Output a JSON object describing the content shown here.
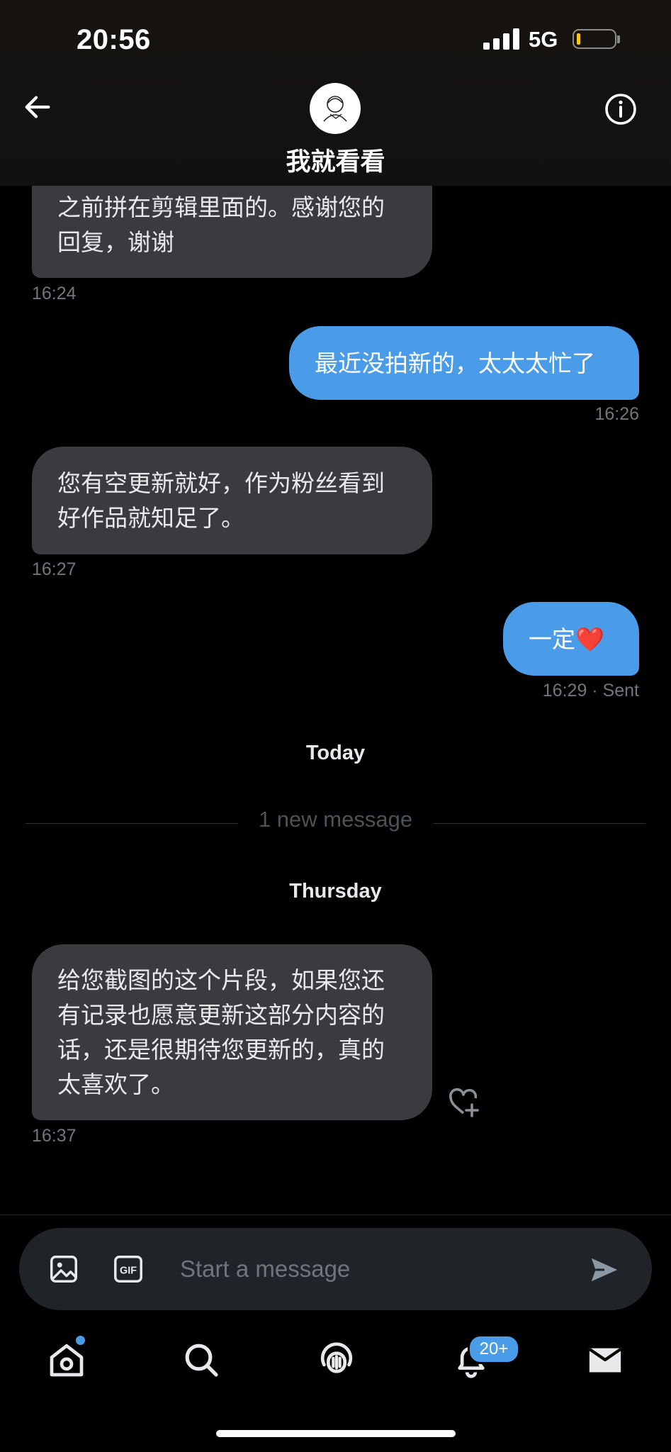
{
  "status_bar": {
    "time": "20:56",
    "network": "5G"
  },
  "header": {
    "title": "我就看看"
  },
  "messages": [
    {
      "lines": [
        "之前拼在剪辑里面的。感谢您的",
        "回复，谢谢"
      ],
      "time": "16:24"
    },
    {
      "lines": [
        "最近没拍新的，太太太忙了"
      ],
      "time": "16:26"
    },
    {
      "lines": [
        "您有空更新就好，作为粉丝看到",
        "好作品就知足了。"
      ],
      "time": "16:27"
    },
    {
      "lines": [
        "一定❤️"
      ],
      "time": "16:29 · Sent"
    },
    {
      "lines": [
        "给您截图的这个片段，如果您还",
        "有记录也愿意更新这部分内容的",
        "话，还是很期待您更新的，真的",
        "太喜欢了。"
      ],
      "time": "16:37"
    }
  ],
  "separators": {
    "today": "Today",
    "new_message": "1 new message",
    "thursday": "Thursday"
  },
  "composer": {
    "placeholder": "Start a message",
    "icons": [
      "image-icon",
      "gif-icon",
      "send-icon"
    ]
  },
  "tab_bar": {
    "icons": [
      "home-icon",
      "search-icon",
      "spaces-icon",
      "notifications-icon",
      "messages-icon"
    ],
    "notification_badge": "20+"
  },
  "colors": {
    "accent": "#4a9be8",
    "incoming_bubble": "#3a3b3f",
    "background": "#000000"
  }
}
